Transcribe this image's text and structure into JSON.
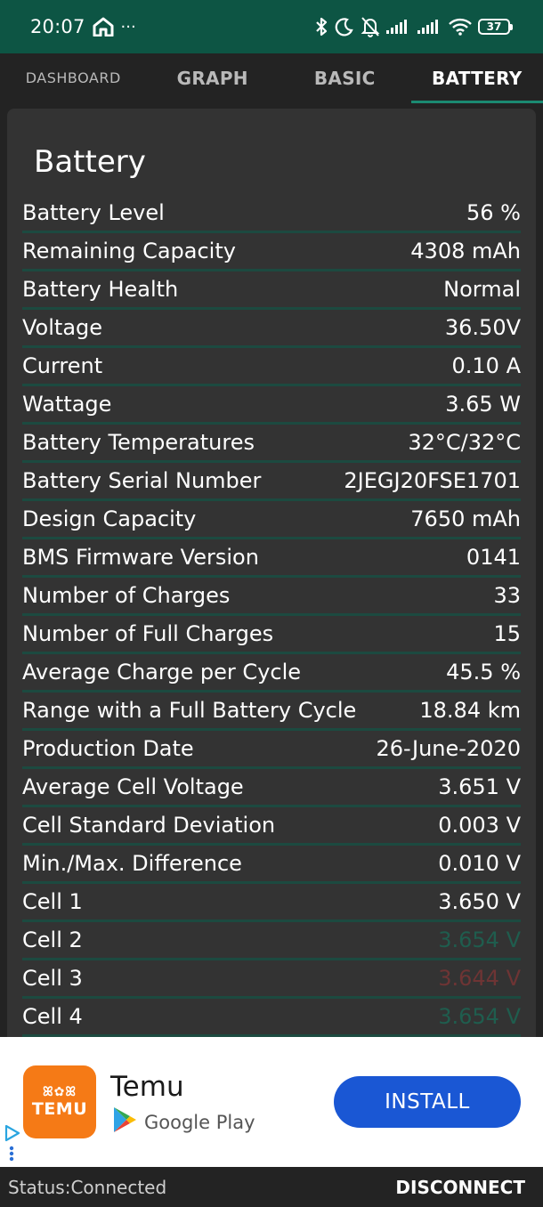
{
  "status_bar": {
    "time": "20:07",
    "more": "···",
    "battery_level": "37",
    "icons": [
      "home-icon",
      "bluetooth-icon",
      "moon-icon",
      "bell-off-icon",
      "signal-icon",
      "signal-icon",
      "wifi-icon",
      "battery-icon"
    ]
  },
  "tabs": [
    {
      "label": "DASHBOARD",
      "active": false
    },
    {
      "label": "GRAPH",
      "active": false
    },
    {
      "label": "BASIC",
      "active": false
    },
    {
      "label": "BATTERY",
      "active": true
    }
  ],
  "card": {
    "title": "Battery",
    "rows": [
      {
        "label": "Battery Level",
        "value": "56 %",
        "color": "#ffffff"
      },
      {
        "label": "Remaining Capacity",
        "value": "4308 mAh",
        "color": "#ffffff"
      },
      {
        "label": "Battery Health",
        "value": "Normal",
        "color": "#ffffff"
      },
      {
        "label": "Voltage",
        "value": "36.50V",
        "color": "#ffffff"
      },
      {
        "label": "Current",
        "value": "0.10 A",
        "color": "#ffffff"
      },
      {
        "label": "Wattage",
        "value": "3.65 W",
        "color": "#ffffff"
      },
      {
        "label": "Battery Temperatures",
        "value": "32°C/32°C",
        "color": "#ffffff"
      },
      {
        "label": "Battery Serial Number",
        "value": "2JEGJ20FSE1701",
        "color": "#ffffff"
      },
      {
        "label": "Design Capacity",
        "value": "7650 mAh",
        "color": "#ffffff"
      },
      {
        "label": "BMS Firmware Version",
        "value": "0141",
        "color": "#ffffff"
      },
      {
        "label": "Number of Charges",
        "value": "33",
        "color": "#ffffff"
      },
      {
        "label": "Number of Full Charges",
        "value": "15",
        "color": "#ffffff"
      },
      {
        "label": "Average Charge per Cycle",
        "value": "45.5 %",
        "color": "#ffffff"
      },
      {
        "label": "Range with a Full Battery Cycle",
        "value": "18.84 km",
        "color": "#ffffff"
      },
      {
        "label": "Production Date",
        "value": "26-June-2020",
        "color": "#ffffff"
      },
      {
        "label": "Average Cell Voltage",
        "value": "3.651 V",
        "color": "#ffffff"
      },
      {
        "label": "Cell Standard Deviation",
        "value": "0.003 V",
        "color": "#ffffff"
      },
      {
        "label": "Min./Max. Difference",
        "value": "0.010 V",
        "color": "#ffffff"
      },
      {
        "label": "Cell 1",
        "value": "3.650 V",
        "color": "#ffffff"
      },
      {
        "label": "Cell 2",
        "value": "3.654 V",
        "color": "#1f5d4e"
      },
      {
        "label": "Cell 3",
        "value": "3.644 V",
        "color": "#6e3434"
      },
      {
        "label": "Cell 4",
        "value": "3.654 V",
        "color": "#1f5d4e"
      }
    ]
  },
  "ad": {
    "app_name": "Temu",
    "logo_glyphs": "ꕤ✿ꕤ",
    "logo_text": "TEMU",
    "store": "Google Play",
    "install_label": "INSTALL",
    "brand_color": "#f57a16",
    "button_color": "#1a57d4"
  },
  "footer": {
    "status": "Status:Connected",
    "disconnect_label": "DISCONNECT"
  }
}
